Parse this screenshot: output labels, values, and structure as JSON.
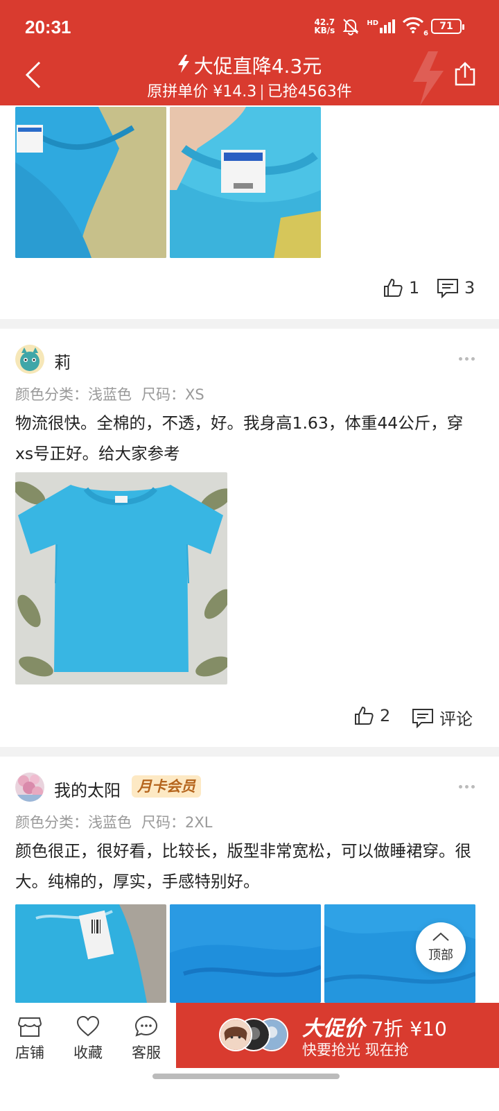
{
  "status_bar": {
    "time": "20:31",
    "net_speed": "42.7",
    "net_unit": "KB/s",
    "signal_label": "HD",
    "wifi_label": "6",
    "battery": "71"
  },
  "header": {
    "title": "大促直降4.3元",
    "subtitle_price": "原拼单价 ¥14.3",
    "subtitle_sold": "已抢4563件"
  },
  "review1": {
    "likes": "1",
    "comments": "3"
  },
  "review2": {
    "username": "莉",
    "spec_color": "颜色分类：浅蓝色",
    "spec_size": "尺码：XS",
    "text": "物流很快。全棉的，不透，好。我身高1.63，体重44公斤，穿xs号正好。给大家参考",
    "likes": "2",
    "comment_label": "评论"
  },
  "review3": {
    "username": "我的太阳",
    "badge": "月卡会员",
    "spec_color": "颜色分类：浅蓝色",
    "spec_size": "尺码：2XL",
    "text": "颜色很正，很好看，比较长，版型非常宽松，可以做睡裙穿。很大。纯棉的，厚实，手感特别好。"
  },
  "back_to_top": "顶部",
  "bottom_bar": {
    "store": "店铺",
    "favorite": "收藏",
    "service": "客服",
    "promo_label": "大促价",
    "promo_discount": "7折",
    "promo_price": "¥10",
    "promo_sub": "快要抢光 现在抢"
  },
  "colors": {
    "brand_red": "#d93b2f",
    "shirt_blue": "#38b6e3"
  }
}
